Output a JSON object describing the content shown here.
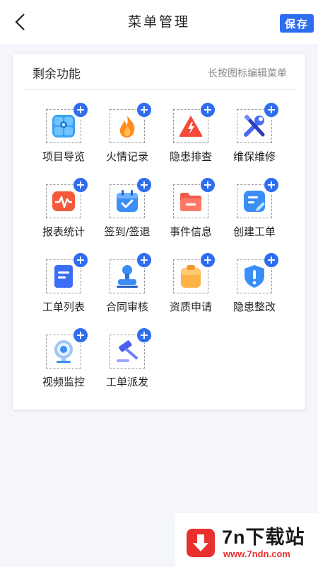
{
  "header": {
    "title": "菜单管理",
    "save_label": "保存"
  },
  "card": {
    "title": "剩余功能",
    "hint": "长按图标编辑菜单"
  },
  "items": [
    {
      "label": "项目导览",
      "icon": "map-grid-icon"
    },
    {
      "label": "火情记录",
      "icon": "flame-icon"
    },
    {
      "label": "隐患排查",
      "icon": "warning-triangle-icon"
    },
    {
      "label": "维保维修",
      "icon": "wrench-screwdriver-icon"
    },
    {
      "label": "报表统计",
      "icon": "pulse-chart-icon"
    },
    {
      "label": "签到/签退",
      "icon": "calendar-check-icon"
    },
    {
      "label": "事件信息",
      "icon": "folder-icon"
    },
    {
      "label": "创建工单",
      "icon": "edit-document-icon"
    },
    {
      "label": "工单列表",
      "icon": "list-document-icon"
    },
    {
      "label": "合同审核",
      "icon": "stamp-icon"
    },
    {
      "label": "资质申请",
      "icon": "clipboard-icon"
    },
    {
      "label": "隐患整改",
      "icon": "shield-alert-icon"
    },
    {
      "label": "视频监控",
      "icon": "webcam-icon"
    },
    {
      "label": "工单派发",
      "icon": "gavel-icon"
    }
  ],
  "add_symbol": "+",
  "watermark": {
    "title": "7n下载站",
    "url": "www.7ndn.com"
  },
  "colors": {
    "accent": "#2f6df0",
    "background": "#f4f6fb"
  }
}
